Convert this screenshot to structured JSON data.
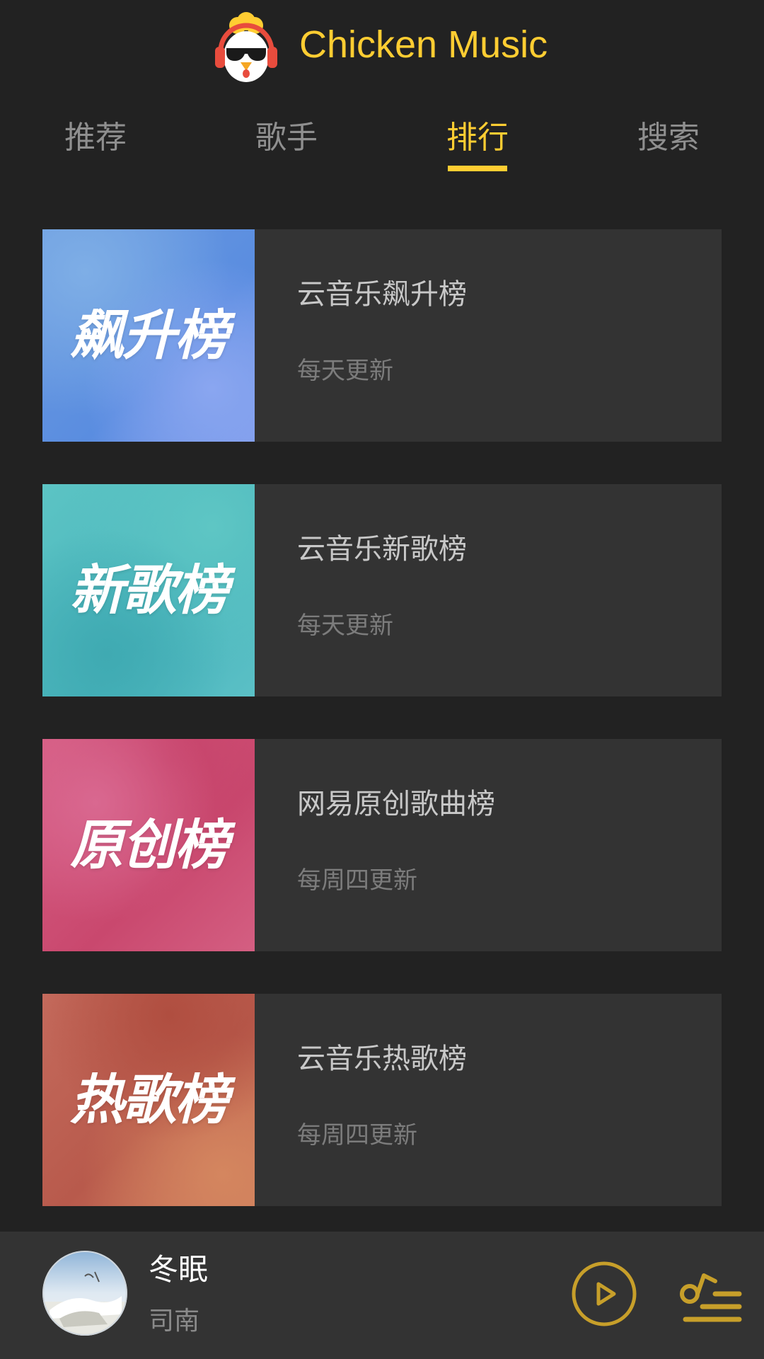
{
  "header": {
    "title": "Chicken Music",
    "logo_icon": "chicken-headphones-icon"
  },
  "tabs": [
    {
      "label": "推荐",
      "active": false
    },
    {
      "label": "歌手",
      "active": false
    },
    {
      "label": "排行",
      "active": true
    },
    {
      "label": "搜索",
      "active": false
    }
  ],
  "ranks": [
    {
      "name": "云音乐飙升榜",
      "update": "每天更新",
      "cover_text": "飙升榜",
      "colors": [
        "#6e9fe6",
        "#5b8fe0",
        "#8aa6f0"
      ]
    },
    {
      "name": "云音乐新歌榜",
      "update": "每天更新",
      "cover_text": "新歌榜",
      "colors": [
        "#5cc4c4",
        "#49b4bc",
        "#5bc0c6"
      ]
    },
    {
      "name": "网易原创歌曲榜",
      "update": "每周四更新",
      "cover_text": "原创榜",
      "colors": [
        "#d75f86",
        "#c8466c",
        "#d65c80"
      ]
    },
    {
      "name": "云音乐热歌榜",
      "update": "每周四更新",
      "cover_text": "热歌榜",
      "colors": [
        "#c4685a",
        "#b5584a",
        "#cf8060"
      ]
    }
  ],
  "player": {
    "song": "冬眠",
    "artist": "司南",
    "cover_icon": "album-cover-image",
    "play_icon": "play-circle-icon",
    "playlist_icon": "playlist-icon",
    "accent": "#ffcd32"
  },
  "theme": {
    "background": "#222222",
    "card": "#333333",
    "accent": "#ffcd32"
  }
}
